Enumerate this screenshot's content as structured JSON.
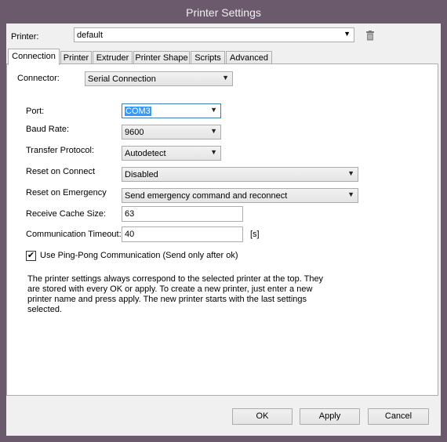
{
  "window": {
    "title": "Printer Settings"
  },
  "printer": {
    "label": "Printer:",
    "value": "default",
    "trash_icon": "trash-icon"
  },
  "tabs": [
    {
      "label": "Connection"
    },
    {
      "label": "Printer"
    },
    {
      "label": "Extruder"
    },
    {
      "label": "Printer Shape"
    },
    {
      "label": "Scripts"
    },
    {
      "label": "Advanced"
    }
  ],
  "connection": {
    "connector_label": "Connector:",
    "connector_value": "Serial Connection",
    "port_label": "Port:",
    "port_value": "COM3",
    "baud_label": "Baud Rate:",
    "baud_value": "9600",
    "protocol_label": "Transfer Protocol:",
    "protocol_value": "Autodetect",
    "reset_connect_label": "Reset on Connect",
    "reset_connect_value": "Disabled",
    "reset_emergency_label": "Reset on Emergency",
    "reset_emergency_value": "Send emergency command and reconnect",
    "cache_label": "Receive Cache Size:",
    "cache_value": "63",
    "timeout_label": "Communication Timeout:",
    "timeout_value": "40",
    "timeout_unit": "[s]",
    "pingpong_label": "Use Ping-Pong Communication (Send only after ok)",
    "pingpong_checked": true,
    "note_lines": [
      "The printer settings always correspond to the selected printer at the top. They",
      "are stored with every OK or apply. To create a new printer, just enter a new",
      "printer name and press apply. The new printer starts with the last settings",
      "selected."
    ]
  },
  "buttons": {
    "ok": "OK",
    "apply": "Apply",
    "cancel": "Cancel"
  }
}
